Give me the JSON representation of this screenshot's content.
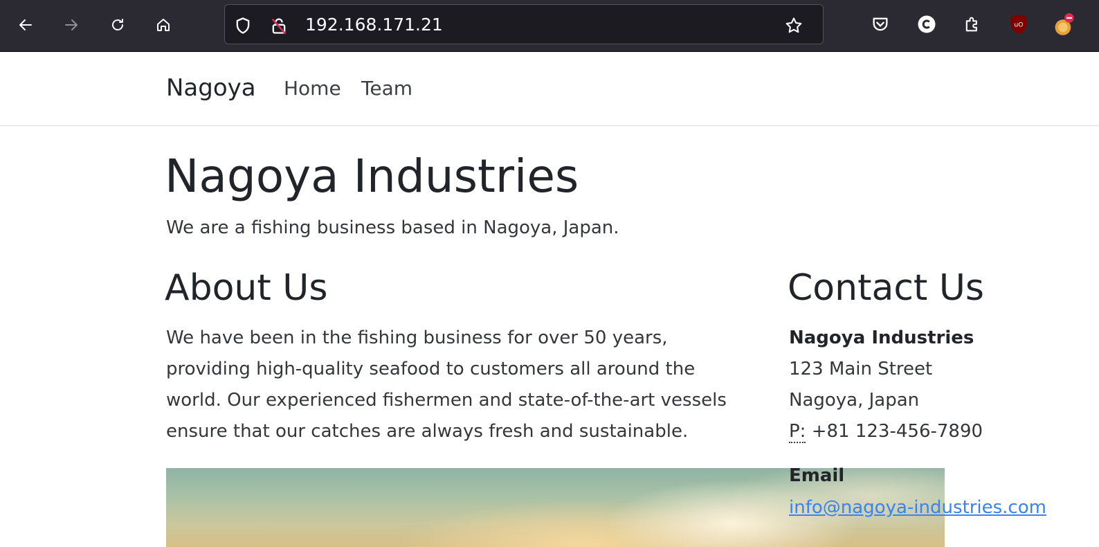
{
  "browser": {
    "url": "192.168.171.21"
  },
  "navbar": {
    "brand": "Nagoya",
    "links": [
      {
        "label": "Home"
      },
      {
        "label": "Team"
      }
    ]
  },
  "hero": {
    "title": "Nagoya Industries",
    "lead": "We are a fishing business based in Nagoya, Japan."
  },
  "about": {
    "heading": "About Us",
    "text": "We have been in the fishing business for over 50 years, providing high-quality seafood to customers all around the world. Our experienced fishermen and state-of-the-art vessels ensure that our catches are always fresh and sustainable."
  },
  "contact": {
    "heading": "Contact Us",
    "company": "Nagoya Industries",
    "street": "123 Main Street",
    "city": "Nagoya, Japan",
    "phone_label": "P:",
    "phone": "+81 123-456-7890",
    "email_label": "Email",
    "email": "info@nagoya-industries.com"
  },
  "colors": {
    "toolbar": "#2b2a33",
    "urlbar": "#1c1b22",
    "link": "#3b82f6"
  }
}
